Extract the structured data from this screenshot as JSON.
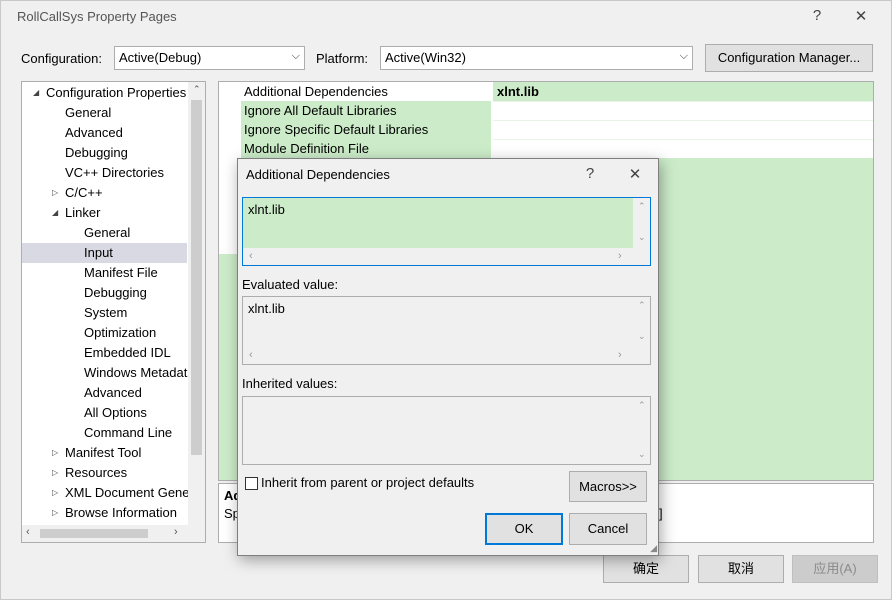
{
  "window": {
    "title": "RollCallSys Property Pages",
    "help_glyph": "?",
    "close_glyph": "✕"
  },
  "toolbar": {
    "configuration_label": "Configuration:",
    "configuration_value": "Active(Debug)",
    "platform_label": "Platform:",
    "platform_value": "Active(Win32)",
    "config_manager_label": "Configuration Manager..."
  },
  "tree": {
    "items": [
      {
        "label": "Configuration Properties",
        "expander": "◢"
      },
      {
        "label": "General"
      },
      {
        "label": "Advanced"
      },
      {
        "label": "Debugging"
      },
      {
        "label": "VC++ Directories"
      },
      {
        "label": "C/C++",
        "expander": "▷"
      },
      {
        "label": "Linker",
        "expander": "◢"
      },
      {
        "label": "General"
      },
      {
        "label": "Input"
      },
      {
        "label": "Manifest File"
      },
      {
        "label": "Debugging"
      },
      {
        "label": "System"
      },
      {
        "label": "Optimization"
      },
      {
        "label": "Embedded IDL"
      },
      {
        "label": "Windows Metadata"
      },
      {
        "label": "Advanced"
      },
      {
        "label": "All Options"
      },
      {
        "label": "Command Line"
      },
      {
        "label": "Manifest Tool",
        "expander": "▷"
      },
      {
        "label": "Resources",
        "expander": "▷"
      },
      {
        "label": "XML Document Generator",
        "expander": "▷"
      },
      {
        "label": "Browse Information",
        "expander": "▷"
      }
    ]
  },
  "grid": {
    "rows": [
      {
        "name": "Additional Dependencies",
        "value": "xlnt.lib"
      },
      {
        "name": "Ignore All Default Libraries",
        "value": ""
      },
      {
        "name": "Ignore Specific Default Libraries",
        "value": ""
      },
      {
        "name": "Module Definition File",
        "value": ""
      }
    ]
  },
  "description": {
    "title_fragment": "Ad",
    "text_fragment": "Sp",
    "right_fragment": "]"
  },
  "footer": {
    "ok_label": "确定",
    "cancel_label": "取消",
    "apply_label": "应用(A)"
  },
  "dialog": {
    "title": "Additional Dependencies",
    "help_glyph": "?",
    "close_glyph": "✕",
    "edit_value": "xlnt.lib",
    "evaluated_label": "Evaluated value:",
    "evaluated_value": "xlnt.lib",
    "inherited_label": "Inherited values:",
    "inherited_value": "",
    "inherit_checkbox_label": "Inherit from parent or project defaults",
    "inherit_checked": false,
    "macros_label": "Macros>>",
    "ok_label": "OK",
    "cancel_label": "Cancel"
  },
  "colors": {
    "selection_green": "#ccecc9",
    "focus_blue": "#0078d7"
  }
}
